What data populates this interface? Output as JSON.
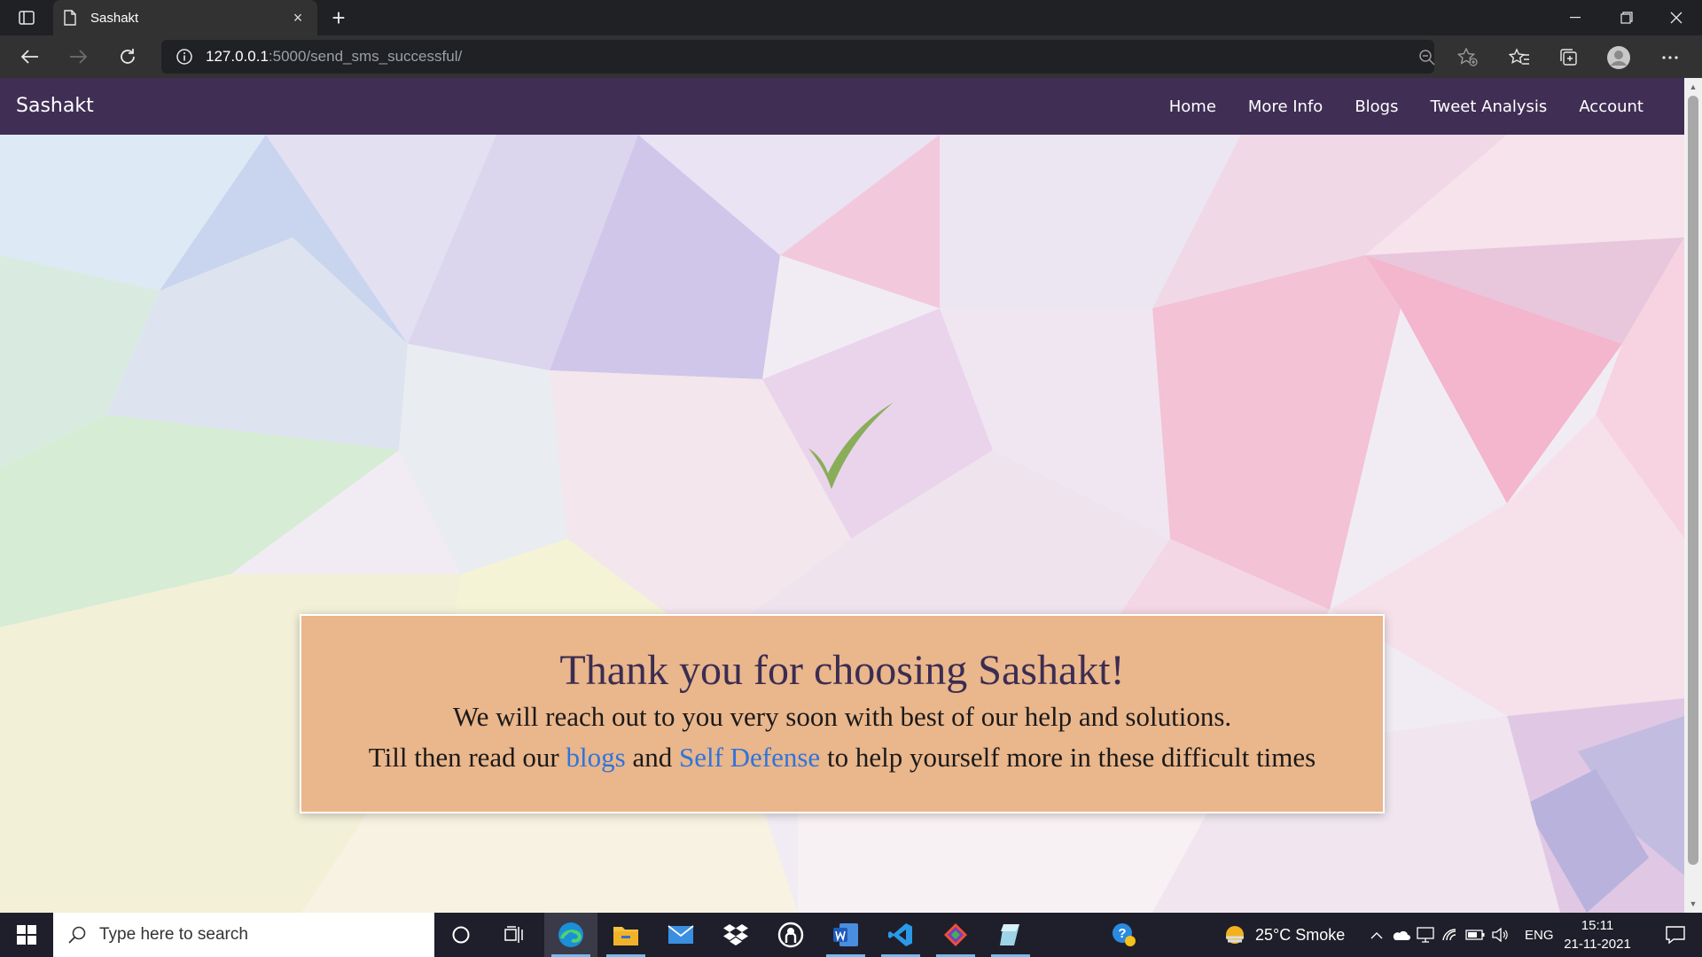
{
  "browser": {
    "tab_title": "Sashakt",
    "url_host": "127.0.0.1",
    "url_rest": ":5000/send_sms_successful/"
  },
  "site": {
    "brand": "Sashakt",
    "nav": [
      "Home",
      "More Info",
      "Blogs",
      "Tweet Analysis",
      "Account"
    ],
    "checkmark": "✓",
    "message": {
      "title": "Thank you for choosing Sashakt!",
      "line1": "We will reach out to you very soon with best of our help and solutions.",
      "line2_prefix": "Till then read our",
      "link_blogs": "blogs",
      "line2_and": "and",
      "link_self_defense": "Self Defense",
      "line2_suffix": "to help yourself more in these difficult times"
    },
    "colors": {
      "navbar": "#402e55",
      "card": "#eab68b",
      "title": "#3b2d52",
      "link": "#2f74dc",
      "check": "#8aad5a"
    }
  },
  "taskbar": {
    "search_placeholder": "Type here to search",
    "weather": "25°C  Smoke",
    "language": "ENG",
    "time": "15:11",
    "date": "21-11-2021"
  }
}
